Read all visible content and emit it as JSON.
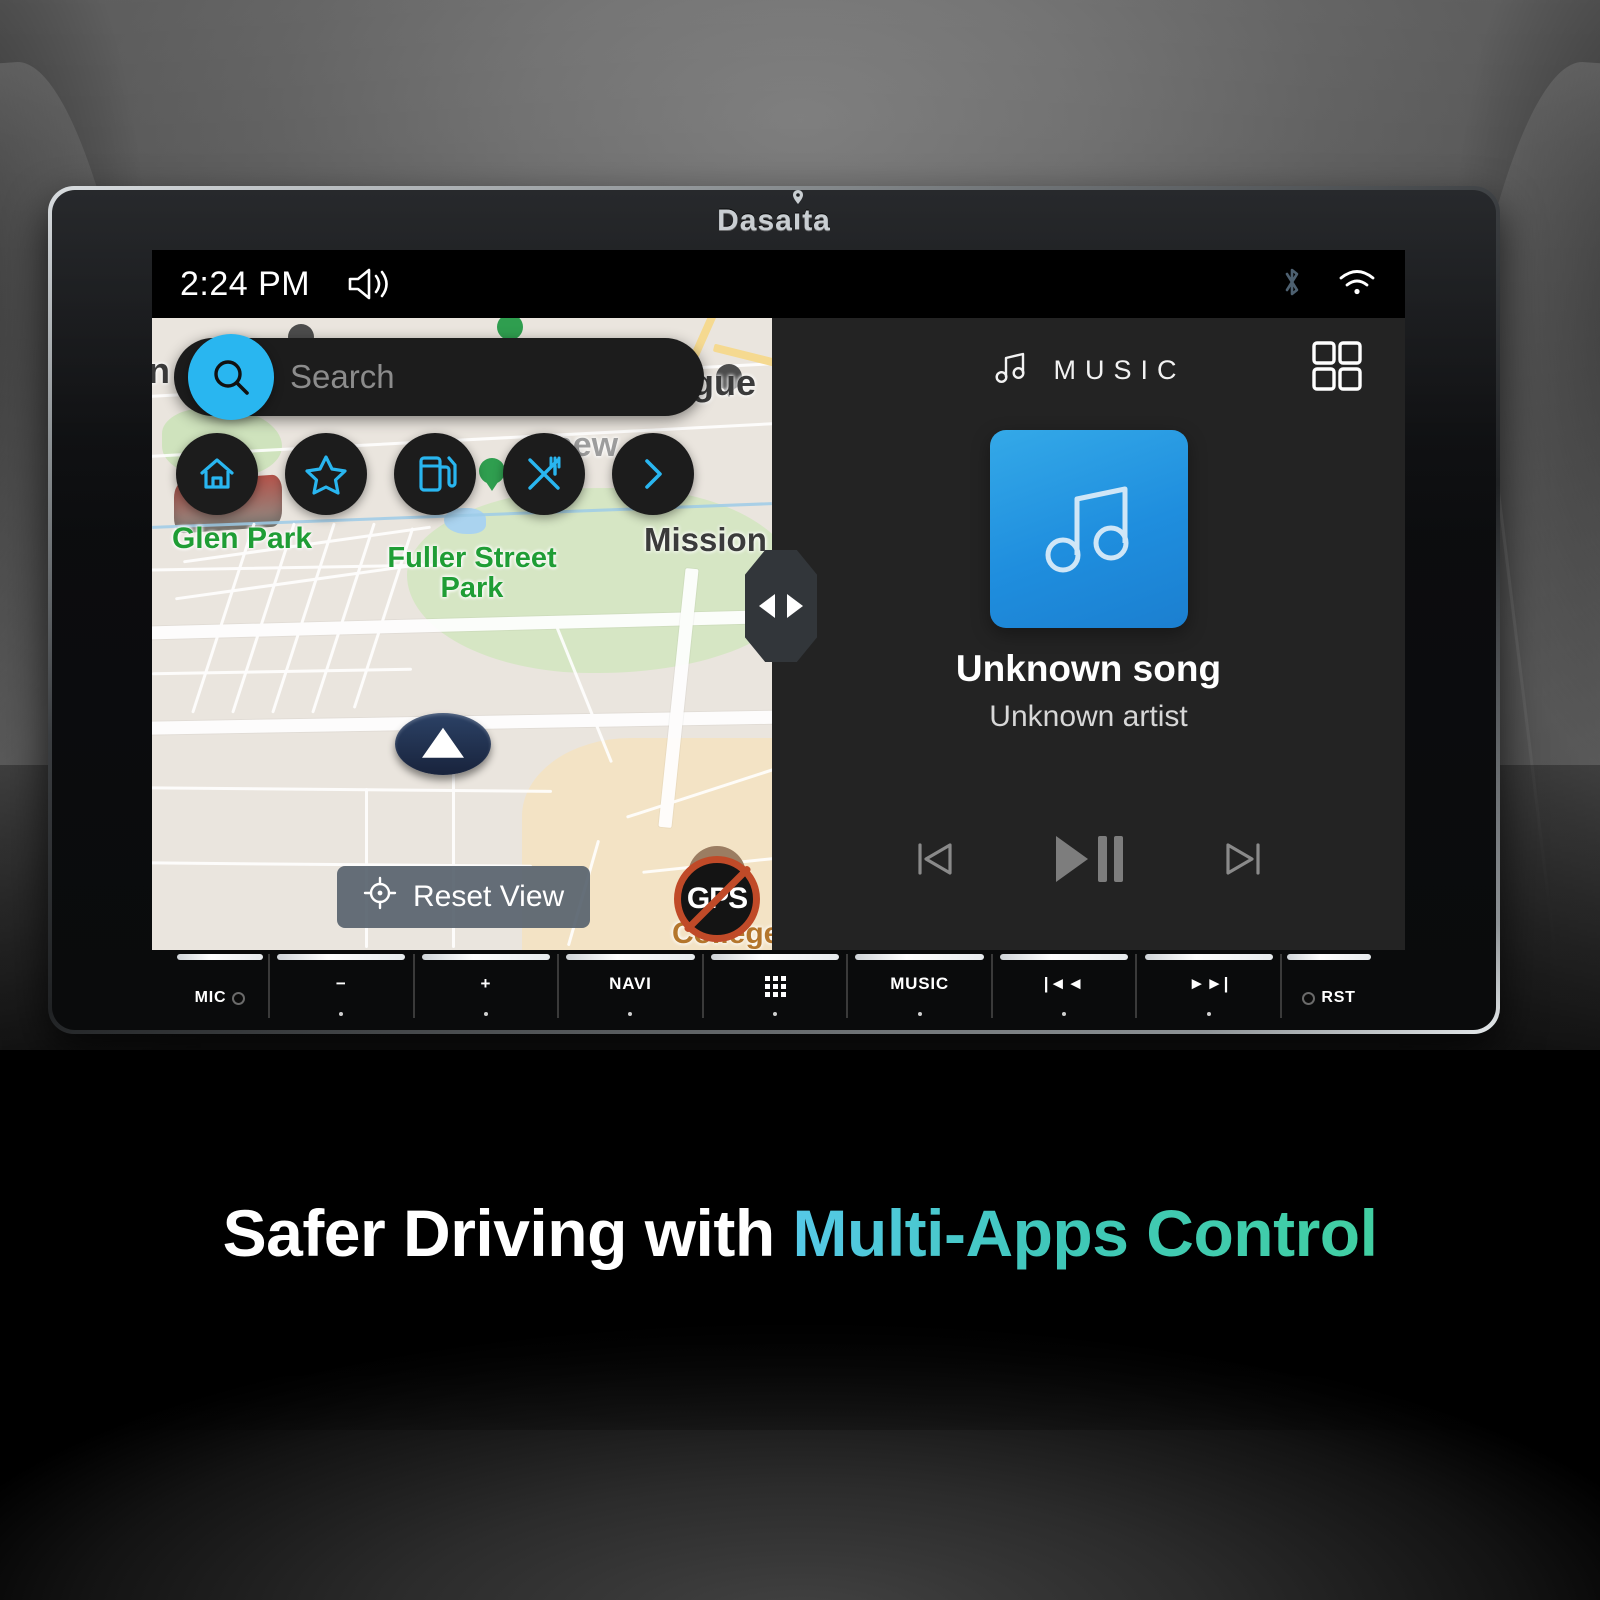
{
  "device": {
    "brand": "Dasaita"
  },
  "statusbar": {
    "time": "2:24 PM",
    "volume_icon": "volume-icon",
    "bluetooth_icon": "bluetooth-icon",
    "wifi_icon": "wifi-icon"
  },
  "map": {
    "search": {
      "placeholder": "Search",
      "icon": "search-icon"
    },
    "quick_buttons": [
      {
        "name": "home",
        "icon": "home-icon"
      },
      {
        "name": "favorites",
        "icon": "star-icon"
      },
      {
        "name": "fuel",
        "icon": "gas-pump-icon"
      },
      {
        "name": "restaurants",
        "icon": "cutlery-icon"
      },
      {
        "name": "more",
        "icon": "chevron-right-icon"
      }
    ],
    "labels": [
      {
        "text": "n P",
        "kind": "dark"
      },
      {
        "text": "gue",
        "kind": "dark"
      },
      {
        "text": "new",
        "kind": "gray"
      },
      {
        "text": "Glen Park",
        "kind": "green"
      },
      {
        "text": "Fuller Street\nPark",
        "kind": "green"
      },
      {
        "text": "Mission",
        "kind": "dark"
      },
      {
        "text": "College",
        "kind": "tan"
      }
    ],
    "reset_view": {
      "label": "Reset View",
      "icon": "crosshair-icon"
    },
    "gps_badge": {
      "label": "GPS",
      "state": "no-signal"
    },
    "divider": {
      "icon_left": "triangle-left-icon",
      "icon_right": "triangle-right-icon"
    }
  },
  "music": {
    "header_title": "MUSIC",
    "header_icon": "music-note-icon",
    "grid_button_icon": "app-grid-icon",
    "album_art_icon": "music-note-icon",
    "song_title": "Unknown song",
    "artist": "Unknown artist",
    "controls": [
      {
        "name": "previous",
        "icon": "skip-back-icon"
      },
      {
        "name": "play-pause",
        "icon": "play-pause-icon"
      },
      {
        "name": "next",
        "icon": "skip-forward-icon"
      }
    ]
  },
  "hardware_buttons": [
    {
      "label": "MIC",
      "type": "mic"
    },
    {
      "label": "−",
      "type": "text"
    },
    {
      "label": "+",
      "type": "text"
    },
    {
      "label": "NAVI",
      "type": "text"
    },
    {
      "label": "",
      "type": "grid"
    },
    {
      "label": "MUSIC",
      "type": "text"
    },
    {
      "label": "|◄◄",
      "type": "text"
    },
    {
      "label": "►►|",
      "type": "text"
    },
    {
      "label": "RST",
      "type": "rst"
    }
  ],
  "caption": {
    "part1": "Safer Driving with ",
    "part2": "Multi-Apps Control"
  },
  "colors": {
    "accent_cyan": "#29b6f0",
    "map_green_label": "#1f9d35",
    "caption_gradient_start": "#56c9e8",
    "caption_gradient_end": "#41cfa2",
    "album_blue": "#1f8ede",
    "gps_red": "#c04a28"
  }
}
